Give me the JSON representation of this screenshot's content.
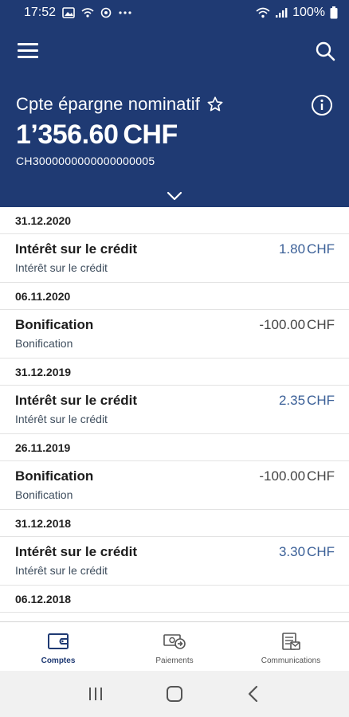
{
  "status": {
    "time": "17:52",
    "battery": "100%",
    "left_icons": [
      "gallery-icon",
      "wifi-call-icon",
      "sync-icon",
      "more-dots-icon"
    ],
    "right_icons": [
      "wifi-icon",
      "signal-icon",
      "battery-icon"
    ]
  },
  "header": {
    "account_name": "Cpte épargne nominatif",
    "balance_amount": "1’356.60",
    "balance_currency": "CHF",
    "iban": "CH3000000000000000005"
  },
  "transactions": [
    {
      "date": "31.12.2020",
      "title": "Intérêt sur le crédit",
      "subtitle": "Intérêt sur le crédit",
      "amount": "1.80",
      "currency": "CHF",
      "direction": "credit"
    },
    {
      "date": "06.11.2020",
      "title": "Bonification",
      "subtitle": "Bonification",
      "amount": "-100.00",
      "currency": "CHF",
      "direction": "debit"
    },
    {
      "date": "31.12.2019",
      "title": "Intérêt sur le crédit",
      "subtitle": "Intérêt sur le crédit",
      "amount": "2.35",
      "currency": "CHF",
      "direction": "credit"
    },
    {
      "date": "26.11.2019",
      "title": "Bonification",
      "subtitle": "Bonification",
      "amount": "-100.00",
      "currency": "CHF",
      "direction": "debit"
    },
    {
      "date": "31.12.2018",
      "title": "Intérêt sur le crédit",
      "subtitle": "Intérêt sur le crédit",
      "amount": "3.30",
      "currency": "CHF",
      "direction": "credit"
    },
    {
      "date": "06.12.2018",
      "title": "",
      "subtitle": "",
      "amount": "",
      "currency": "",
      "direction": ""
    }
  ],
  "tabs": [
    {
      "label": "Comptes",
      "icon": "wallet-icon",
      "active": true
    },
    {
      "label": "Paiements",
      "icon": "payments-icon",
      "active": false
    },
    {
      "label": "Communications",
      "icon": "communications-icon",
      "active": false
    }
  ],
  "colors": {
    "brand": "#1f3a73",
    "credit_amount": "#3a5f97",
    "debit_amount": "#444444"
  }
}
